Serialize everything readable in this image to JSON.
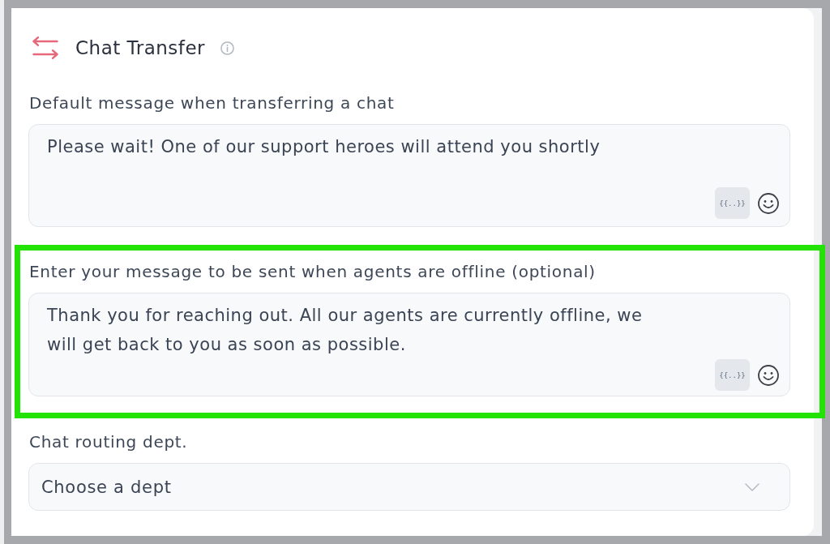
{
  "section": {
    "title": "Chat Transfer"
  },
  "fields": [
    {
      "kind": "textarea",
      "label": "Default message when transferring a chat",
      "value": "Please wait! One of our support heroes will attend you shortly",
      "variable_button": "{{..}}",
      "highlighted": false
    },
    {
      "kind": "textarea",
      "label": "Enter your message to be sent when agents are offline (optional)",
      "value": "Thank you for reaching out. All our agents are currently offline, we will get back to you as soon as possible.",
      "variable_button": "{{..}}",
      "highlighted": true
    },
    {
      "kind": "select",
      "label": "Chat routing dept.",
      "placeholder": "Choose a dept",
      "highlighted": false
    }
  ]
}
